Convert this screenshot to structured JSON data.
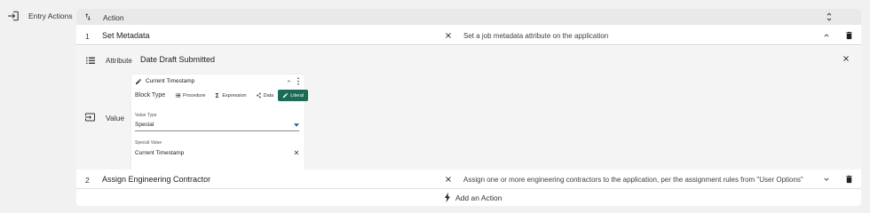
{
  "entry_actions_label": "Entry Actions",
  "table": {
    "header_title": "Action"
  },
  "rows": [
    {
      "number": "1",
      "name": "Set Metadata",
      "description": "Set a job metadata attribute on the application"
    },
    {
      "number": "2",
      "name": "Assign Engineering Contractor",
      "description": "Assign one or more engineering contractors to the application, per the assignment rules from \"User Options\""
    }
  ],
  "detail": {
    "attribute_label": "Attribute",
    "attribute_value": "Date Draft Submitted",
    "value_label": "Value",
    "block": {
      "title": "Current Timestamp",
      "block_type_label": "Block Type",
      "tabs": [
        "Procedure",
        "Expression",
        "Data",
        "Literal"
      ],
      "active_tab": "Literal",
      "value_type_label": "Value Type",
      "value_type_selected": "Special",
      "special_value_label": "Special Value",
      "special_value": "Current Timestamp"
    }
  },
  "add_action_label": "Add an Action",
  "colors": {
    "accent": "#1b6b57",
    "panel": "#ffffff",
    "background": "#f1f1f1",
    "dropdown_arrow": "#1a5fb4"
  }
}
